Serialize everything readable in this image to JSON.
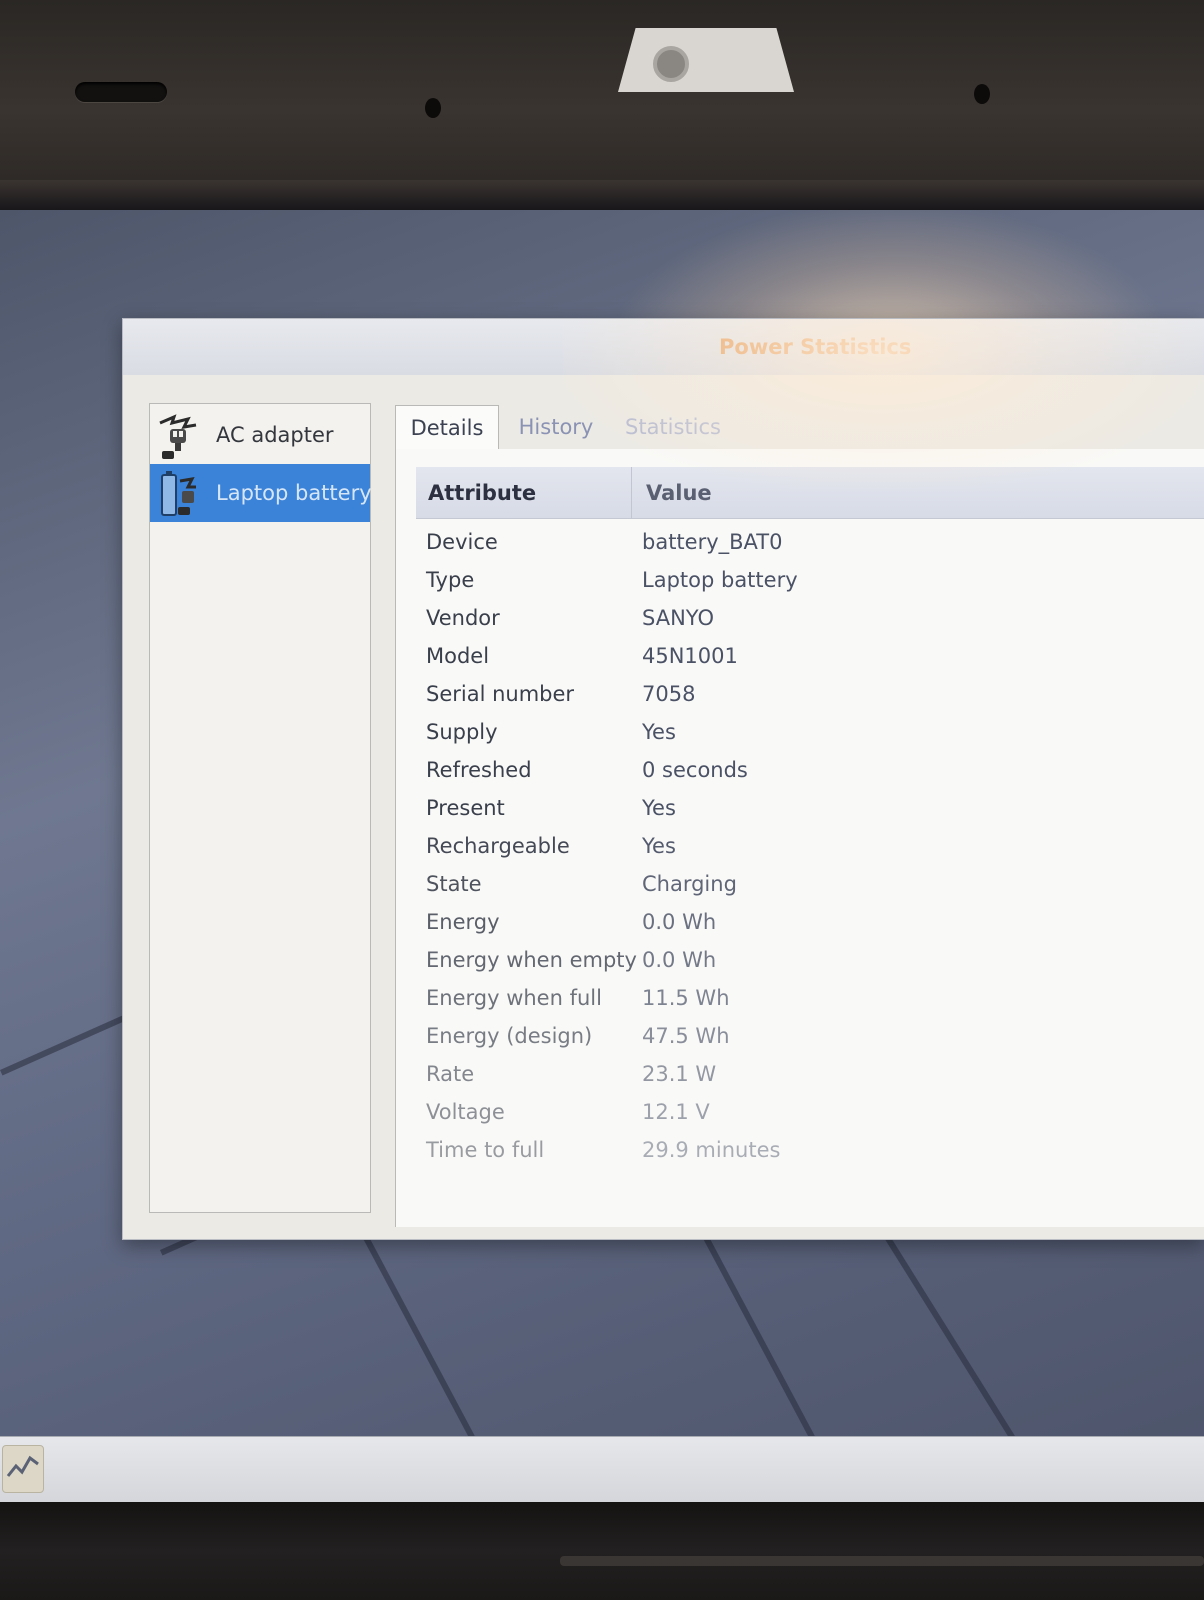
{
  "window": {
    "title": "Power Statistics"
  },
  "devices": [
    {
      "label": "AC adapter",
      "icon": "ac-adapter-icon",
      "selected": false
    },
    {
      "label": "Laptop battery",
      "icon": "battery-icon",
      "selected": true
    }
  ],
  "tabs": [
    {
      "label": "Details",
      "active": true
    },
    {
      "label": "History",
      "active": false
    },
    {
      "label": "Statistics",
      "active": false
    }
  ],
  "table": {
    "columns": [
      "Attribute",
      "Value"
    ],
    "rows": [
      {
        "attribute": "Device",
        "value": "battery_BAT0"
      },
      {
        "attribute": "Type",
        "value": "Laptop battery"
      },
      {
        "attribute": "Vendor",
        "value": "SANYO"
      },
      {
        "attribute": "Model",
        "value": "45N1001"
      },
      {
        "attribute": "Serial number",
        "value": "7058"
      },
      {
        "attribute": "Supply",
        "value": "Yes"
      },
      {
        "attribute": "Refreshed",
        "value": "0 seconds"
      },
      {
        "attribute": "Present",
        "value": "Yes"
      },
      {
        "attribute": "Rechargeable",
        "value": "Yes"
      },
      {
        "attribute": "State",
        "value": "Charging"
      },
      {
        "attribute": "Energy",
        "value": "0.0 Wh"
      },
      {
        "attribute": "Energy when empty",
        "value": "0.0 Wh"
      },
      {
        "attribute": "Energy when full",
        "value": "11.5 Wh"
      },
      {
        "attribute": "Energy (design)",
        "value": "47.5 Wh"
      },
      {
        "attribute": "Rate",
        "value": "23.1 W"
      },
      {
        "attribute": "Voltage",
        "value": "12.1 V"
      },
      {
        "attribute": "Time to full",
        "value": "29.9 minutes"
      }
    ]
  },
  "taskbar": {
    "apps": [
      {
        "icon": "power-statistics-icon"
      }
    ]
  },
  "colors": {
    "selection": "#3b83d8",
    "title_text": "#e6a366",
    "attribute_text": "#3a3f4c",
    "value_text": "#4b5266",
    "faded_text": "#a9b0c6"
  }
}
